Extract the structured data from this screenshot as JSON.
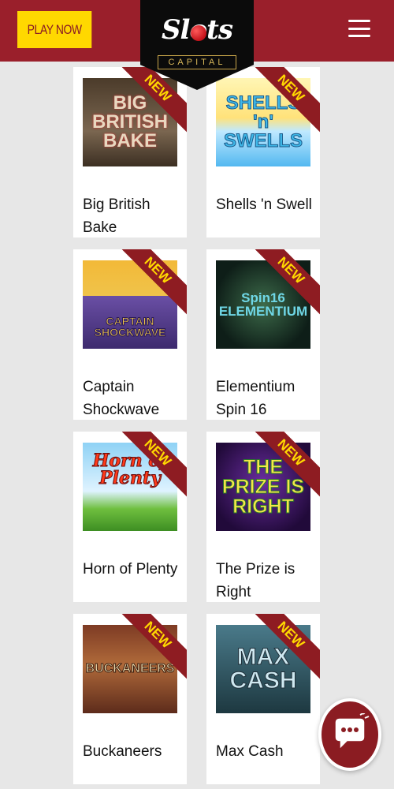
{
  "header": {
    "play_label": "PLAY NOW",
    "logo_main": "Slots",
    "logo_sub": "CAPITAL",
    "background": "#9a1f2b",
    "play_bg": "#ffd800"
  },
  "ribbon_label": "NEW",
  "games": [
    {
      "name": "Big British Bake",
      "art": "BIG BRITISH BAKE"
    },
    {
      "name": "Shells 'n Swell",
      "art": "SHELLS 'n' SWELLS"
    },
    {
      "name": "Captain Shockwave",
      "art": "CAPTAIN SHOCKWAVE"
    },
    {
      "name": "Elementium Spin 16",
      "art": "Spin16 ELEMENTIUM"
    },
    {
      "name": "Horn of Plenty",
      "art": "Horn of Plenty"
    },
    {
      "name": "The Prize is Right",
      "art": "THE PRIZE IS RIGHT"
    },
    {
      "name": "Buckaneers",
      "art": "BUCKANEERS"
    },
    {
      "name": "Max Cash",
      "art": "MAX CASH"
    }
  ],
  "icons": {
    "menu": "hamburger-menu-icon",
    "chat": "chat-bubble-icon"
  },
  "colors": {
    "ribbon": "#8e1c22",
    "ribbon_text": "#ffd800",
    "page_bg": "#e7e7e7"
  }
}
